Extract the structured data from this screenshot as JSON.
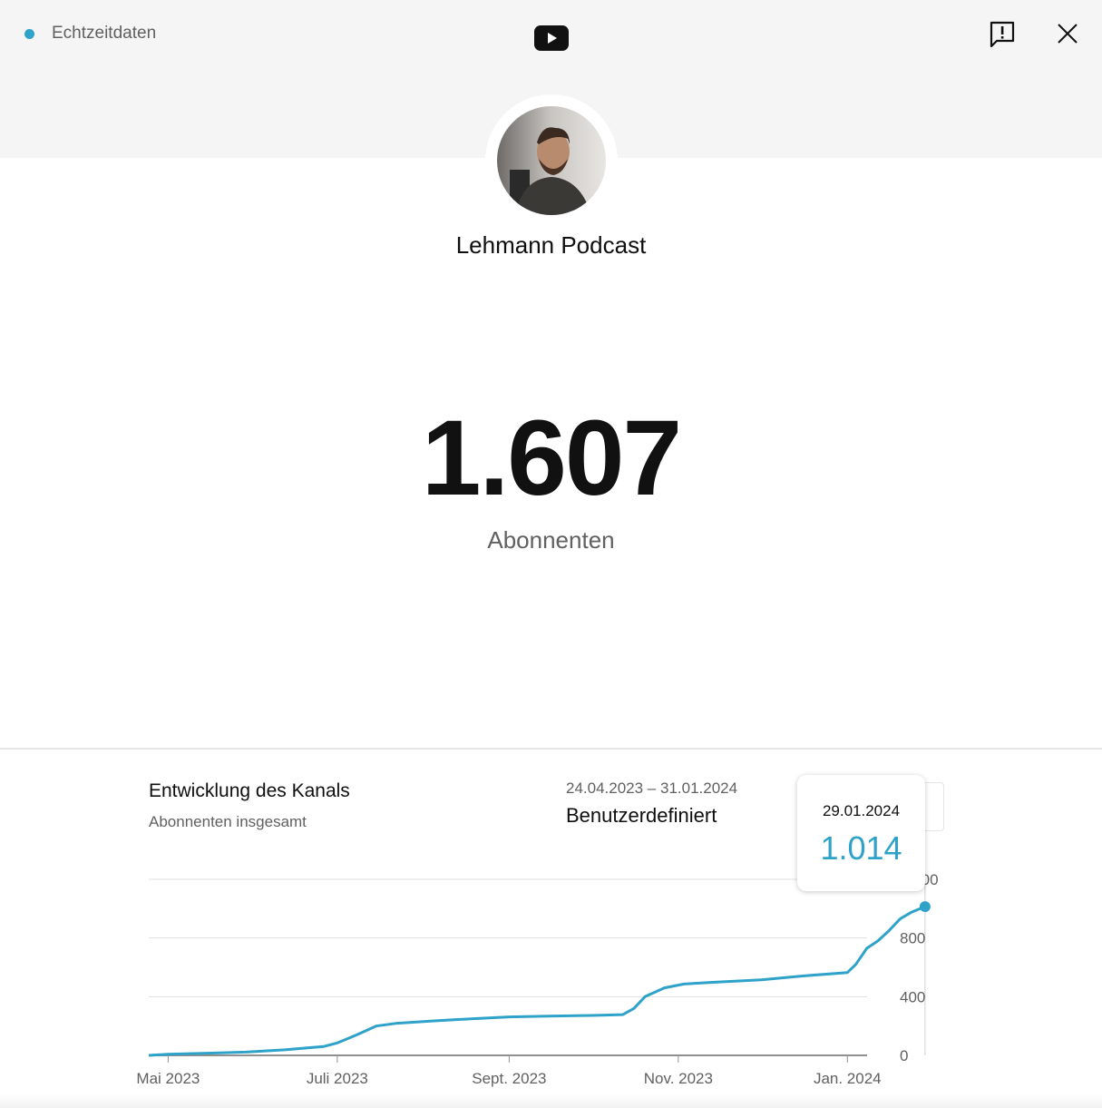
{
  "header": {
    "live_label": "Echtzeitdaten",
    "live_color": "#2fa2c9",
    "logo_icon": "youtube-logo-icon",
    "feedback_icon": "feedback-icon",
    "close_icon": "close-icon"
  },
  "channel": {
    "name": "Lehmann Podcast",
    "avatar": "channel-avatar"
  },
  "subscribers": {
    "count": "1.607",
    "label": "Abonnenten"
  },
  "chart_panel": {
    "title": "Entwicklung des Kanals",
    "subtitle": "Abonnenten insgesamt",
    "date_range": "24.04.2023 – 31.01.2024",
    "range_mode": "Benutzerdefiniert",
    "tooltip": {
      "date": "29.01.2024",
      "value": "1.014"
    }
  },
  "chart_data": {
    "type": "line",
    "title": "Entwicklung des Kanals",
    "subtitle": "Abonnenten insgesamt",
    "x_tick_labels": [
      "Mai 2023",
      "Juli 2023",
      "Sept. 2023",
      "Nov. 2023",
      "Jan. 2024"
    ],
    "x_tick_dates": [
      "2023-05-01",
      "2023-07-01",
      "2023-09-01",
      "2023-11-01",
      "2024-01-01"
    ],
    "y_tick_labels": [
      "0",
      "400",
      "800",
      "1.200"
    ],
    "y_ticks": [
      0,
      400,
      800,
      1200
    ],
    "xlim": [
      "2023-04-24",
      "2024-01-31"
    ],
    "ylim": [
      0,
      1200
    ],
    "grid": true,
    "line_color": "#2fa2c9",
    "series": [
      {
        "values": [
          [
            "2023-04-24",
            0
          ],
          [
            "2023-05-01",
            8
          ],
          [
            "2023-05-15",
            15
          ],
          [
            "2023-05-29",
            22
          ],
          [
            "2023-06-12",
            38
          ],
          [
            "2023-06-26",
            60
          ],
          [
            "2023-07-01",
            85
          ],
          [
            "2023-07-08",
            140
          ],
          [
            "2023-07-15",
            200
          ],
          [
            "2023-07-22",
            218
          ],
          [
            "2023-08-05",
            235
          ],
          [
            "2023-08-19",
            250
          ],
          [
            "2023-09-01",
            262
          ],
          [
            "2023-09-15",
            268
          ],
          [
            "2023-10-01",
            272
          ],
          [
            "2023-10-12",
            278
          ],
          [
            "2023-10-16",
            320
          ],
          [
            "2023-10-20",
            400
          ],
          [
            "2023-10-27",
            460
          ],
          [
            "2023-11-03",
            486
          ],
          [
            "2023-11-15",
            500
          ],
          [
            "2023-12-01",
            515
          ],
          [
            "2023-12-15",
            540
          ],
          [
            "2024-01-01",
            565
          ],
          [
            "2024-01-04",
            620
          ],
          [
            "2024-01-08",
            730
          ],
          [
            "2024-01-12",
            780
          ],
          [
            "2024-01-16",
            850
          ],
          [
            "2024-01-20",
            930
          ],
          [
            "2024-01-24",
            975
          ],
          [
            "2024-01-29",
            1014
          ]
        ]
      }
    ],
    "highlight": {
      "date": "2024-01-29",
      "value": 1014
    }
  }
}
